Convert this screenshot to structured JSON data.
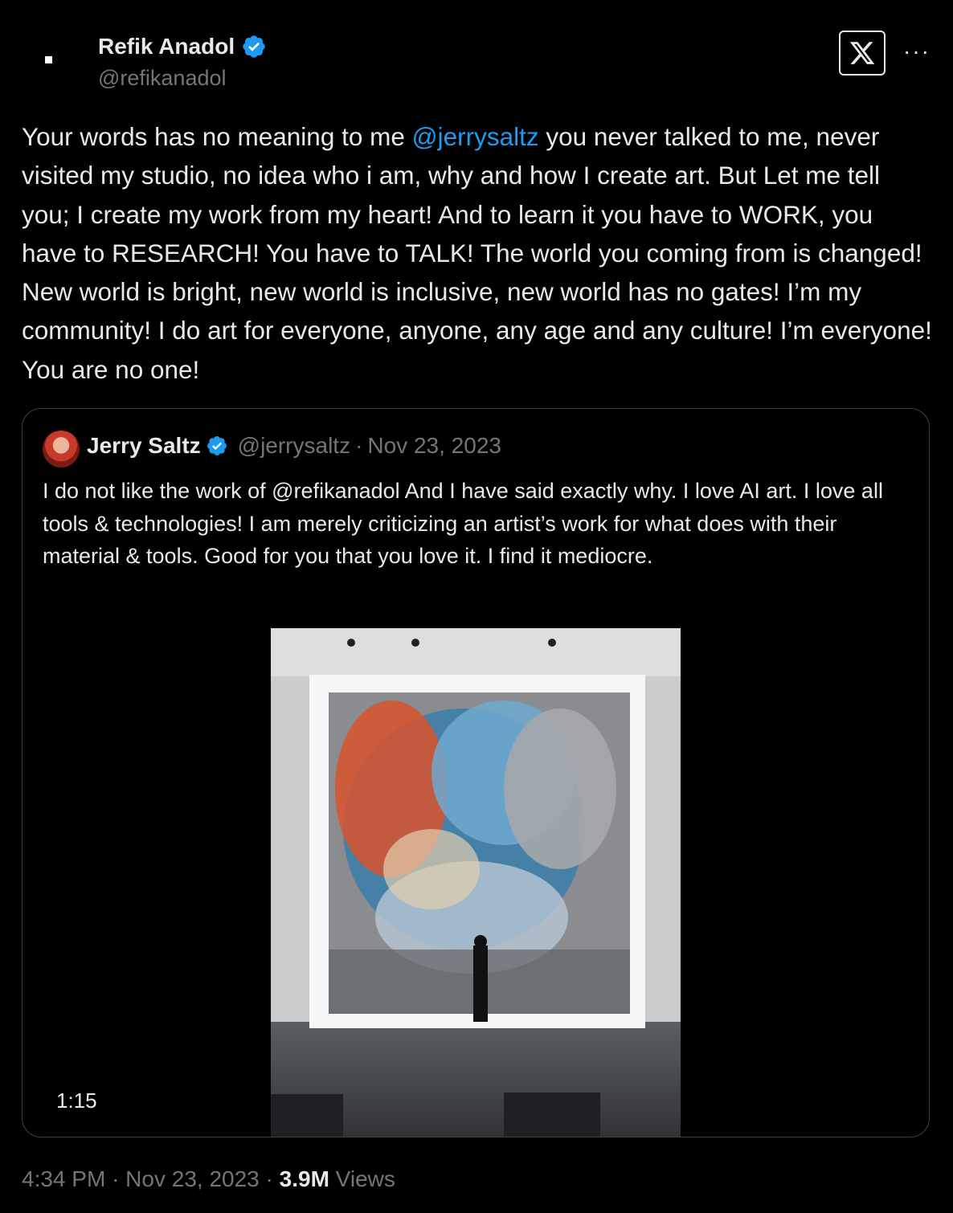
{
  "author": {
    "name": "Refik Anadol",
    "handle": "@refikanadol"
  },
  "tweet": {
    "part1": "Your words has no meaning to me ",
    "mention": "@jerrysaltz",
    "part2": " you never talked to me, never visited my studio, no idea who i am, why and how I create art. But Let me tell you; I create my work from my heart! And to learn it you have to WORK, you have to RESEARCH! You have to TALK! The world you coming from is changed! New world is bright, new world is inclusive, new world has no gates! I’m my community! I do art for everyone, anyone, any age and any culture! I’m everyone! You are no one!"
  },
  "quote": {
    "name": "Jerry Saltz",
    "handle": "@jerrysaltz",
    "date": "Nov 23, 2023",
    "text": "I do not like the work of @refikanadol And I have said exactly why. I love AI art. I love all tools & technologies! I am merely criticizing an artist’s work for what does with their material & tools. Good for you that you love it. I  find it mediocre.",
    "video_duration": "1:15"
  },
  "footer": {
    "time": "4:34 PM",
    "date": "Nov 23, 2023",
    "views_count": "3.9M",
    "views_label": "Views"
  },
  "colors": {
    "background": "#000000",
    "text": "#e7e9ea",
    "secondary": "#71767b",
    "link": "#1d9bf0",
    "verified": "#1d9bf0"
  },
  "icons": [
    "verified-badge-icon",
    "x-logo-icon",
    "more-options-icon"
  ]
}
